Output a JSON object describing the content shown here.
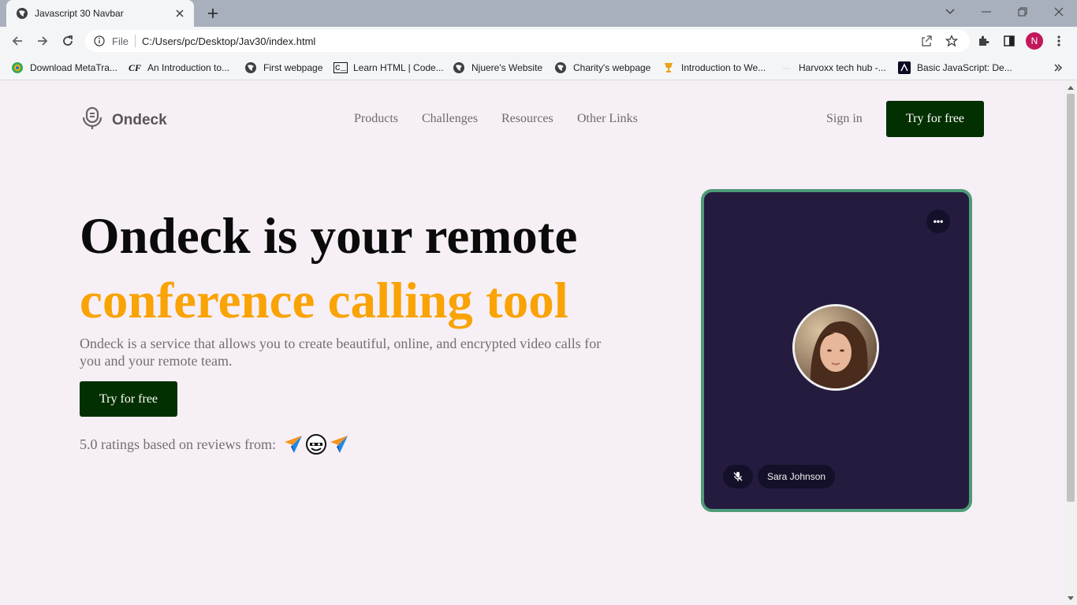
{
  "browser": {
    "tab_title": "Javascript 30 Navbar",
    "address_scheme": "File",
    "address_url": "C:/Users/pc/Desktop/Jav30/index.html",
    "profile_initial": "N",
    "bookmarks": [
      {
        "label": "Download MetaTra...",
        "icon": "metatrader-icon"
      },
      {
        "label": "An Introduction to...",
        "icon": "cf-icon"
      },
      {
        "label": "First webpage",
        "icon": "globe-icon"
      },
      {
        "label": "Learn HTML | Code...",
        "icon": "codecademy-icon"
      },
      {
        "label": "Njuere's Website",
        "icon": "globe-icon"
      },
      {
        "label": "Charity's webpage",
        "icon": "globe-icon"
      },
      {
        "label": "Introduction to We...",
        "icon": "trophy-icon"
      },
      {
        "label": "Harvoxx tech hub -...",
        "icon": "blank-icon"
      },
      {
        "label": "Basic JavaScript: De...",
        "icon": "freecodecamp-icon"
      }
    ],
    "colors": {
      "tabstrip": "#a9b0bd",
      "toolbar": "#f4f5f7"
    }
  },
  "site": {
    "brand": "Ondeck",
    "nav": [
      "Products",
      "Challenges",
      "Resources",
      "Other Links"
    ],
    "sign_in": "Sign in",
    "header_cta": "Try for free",
    "headline_line1": "Ondeck is your remote",
    "headline_line2": "conference calling tool",
    "lead": "Ondeck is a service that allows you to create beautiful, online, and encrypted video calls for you and your remote team.",
    "hero_cta": "Try for free",
    "ratings_text": "5.0 ratings based on reviews from:",
    "review_icons": [
      "paper-plane-icon",
      "ninja-icon",
      "paper-plane-icon"
    ],
    "call": {
      "more_label": "•••",
      "participant_name": "Sara Johnson"
    },
    "colors": {
      "background": "#f7eff6",
      "cta": "#033000",
      "accent": "#f9a305",
      "card": "#241b3f",
      "card_border": "#4e9c78"
    }
  }
}
